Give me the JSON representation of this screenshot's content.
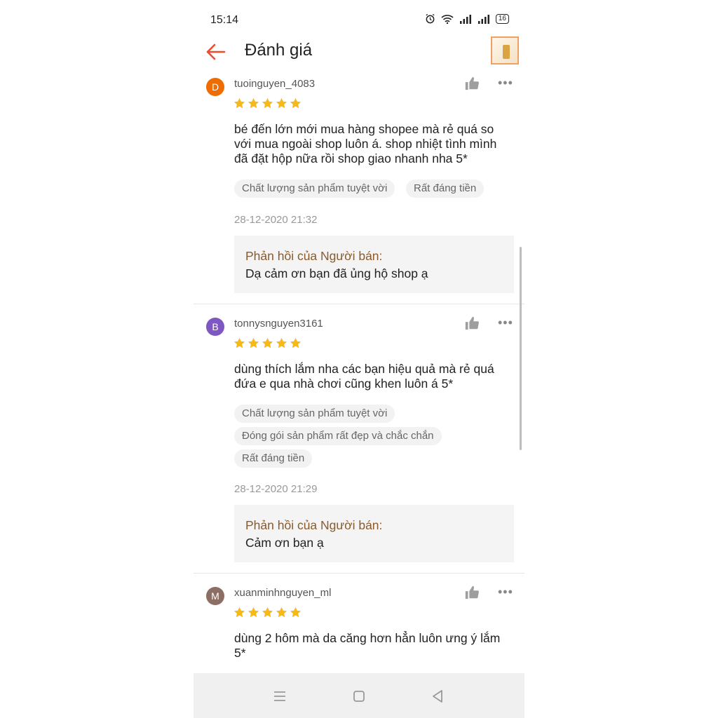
{
  "status_bar": {
    "time": "15:14",
    "battery": "16"
  },
  "header": {
    "title": "Đánh giá",
    "back_icon": "back-arrow-icon",
    "accent": "#ee4d2d"
  },
  "reviews": [
    {
      "avatar_letter": "D",
      "avatar_color": "#ef6c00",
      "username": "tuoinguyen_4083",
      "rating": 5,
      "comment": [
        "bé đến lớn mới mua hàng shopee mà rẻ quá so",
        "với mua ngoài shop luôn á. shop nhiệt tình mình",
        "đã đặt hộp nữa rồi shop giao nhanh nha 5*"
      ],
      "tags": [
        "Chất lượng sản phẩm tuyệt vời",
        "Rất đáng tiền"
      ],
      "date": "28-12-2020 21:32",
      "reply_label": "Phản hồi của Người bán:",
      "reply_text": "Dạ cảm ơn bạn đã ủng hộ shop ạ"
    },
    {
      "avatar_letter": "B",
      "avatar_color": "#7e57c2",
      "username": "tonnysnguyen3161",
      "rating": 5,
      "comment": [
        "dùng thích lắm nha các bạn hiệu quả mà rẻ quá",
        "đứa e qua nhà chơi cũng khen luôn á 5*"
      ],
      "tags": [
        "Chất lượng sản phẩm tuyệt vời",
        "Đóng gói sản phẩm rất đẹp và chắc chắn",
        "Rất đáng tiền"
      ],
      "date": "28-12-2020 21:29",
      "reply_label": "Phản hồi của Người bán:",
      "reply_text": "Cảm ơn bạn ạ"
    },
    {
      "avatar_letter": "M",
      "avatar_color": "#8d6e63",
      "username": "xuanminhnguyen_ml",
      "rating": 5,
      "comment": [
        "dùng 2 hôm mà da căng hơn hẳn luôn ưng ý lắm",
        "5*"
      ]
    }
  ],
  "more_label": "•••",
  "star_color": "#f6b91a"
}
